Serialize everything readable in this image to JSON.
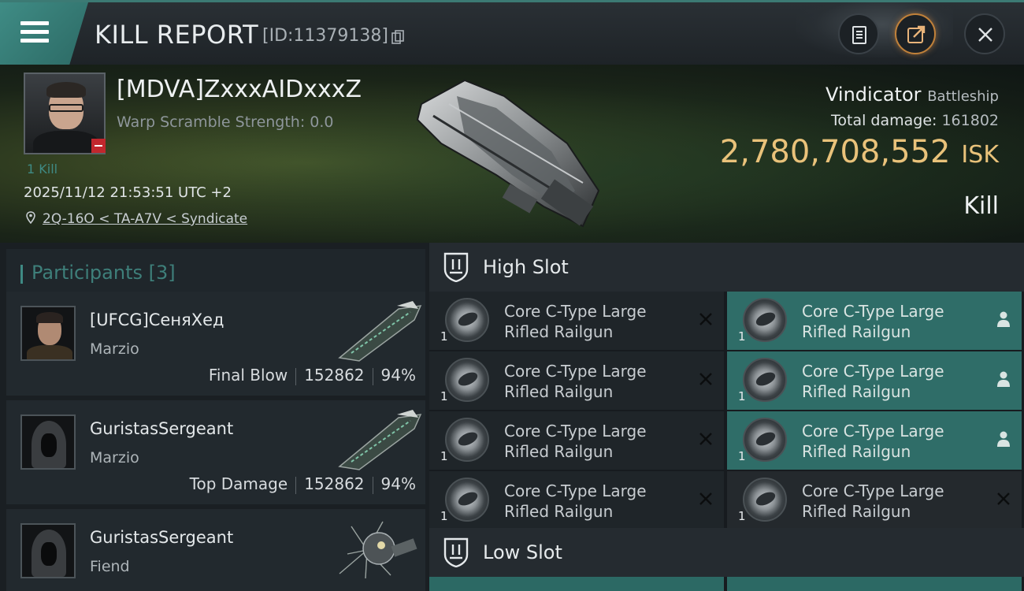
{
  "header": {
    "title": "KILL REPORT",
    "report_id": "[ID:11379138]"
  },
  "victim": {
    "name": "[MDVA]ZxxxAIDxxxZ",
    "warp_scramble": "Warp Scramble Strength: 0.0",
    "kills": "1 Kill",
    "timestamp": "2025/11/12 21:53:51 UTC +2",
    "location": "2Q-16O < TA-A7V < Syndicate",
    "ship_name": "Vindicator",
    "ship_class": "Battleship",
    "total_damage_label": "Total damage:",
    "total_damage": "161802",
    "isk_value": "2,780,708,552",
    "isk_unit": "ISK",
    "result": "Kill"
  },
  "participants": {
    "header": "Participants [3]",
    "items": [
      {
        "name": "[UFCG]СеняХед",
        "ship": "Marzio",
        "tag": "Final Blow",
        "damage": "152862",
        "percent": "94%"
      },
      {
        "name": "GuristasSergeant",
        "ship": "Marzio",
        "tag": "Top Damage",
        "damage": "152862",
        "percent": "94%"
      },
      {
        "name": "GuristasSergeant",
        "ship": "Fiend",
        "tag": "",
        "damage": "",
        "percent": ""
      }
    ]
  },
  "slots": {
    "high_label": "High Slot",
    "low_label": "Low Slot",
    "high": [
      {
        "line1": "Core C-Type Large",
        "line2": "Rifled Railgun",
        "qty": "1",
        "state": "destroyed"
      },
      {
        "line1": "Core C-Type Large",
        "line2": "Rifled Railgun",
        "qty": "1",
        "state": "dropped"
      },
      {
        "line1": "Core C-Type Large",
        "line2": "Rifled Railgun",
        "qty": "1",
        "state": "destroyed"
      },
      {
        "line1": "Core C-Type Large",
        "line2": "Rifled Railgun",
        "qty": "1",
        "state": "dropped"
      },
      {
        "line1": "Core C-Type Large",
        "line2": "Rifled Railgun",
        "qty": "1",
        "state": "destroyed"
      },
      {
        "line1": "Core C-Type Large",
        "line2": "Rifled Railgun",
        "qty": "1",
        "state": "dropped"
      },
      {
        "line1": "Core C-Type Large",
        "line2": "Rifled Railgun",
        "qty": "1",
        "state": "destroyed"
      },
      {
        "line1": "Core C-Type Large",
        "line2": "Rifled Railgun",
        "qty": "1",
        "state": "destroyed"
      }
    ]
  },
  "colors": {
    "accent": "#3f8a84",
    "isk": "#e9c27a",
    "fitted_slot": "#2f6d68",
    "loss_badge": "#c1272d"
  },
  "icons": [
    "menu-icon",
    "copy-icon",
    "clipboard-icon",
    "share-icon",
    "close-icon",
    "location-pin-icon",
    "shield-slot-icon",
    "x-icon",
    "person-icon"
  ]
}
